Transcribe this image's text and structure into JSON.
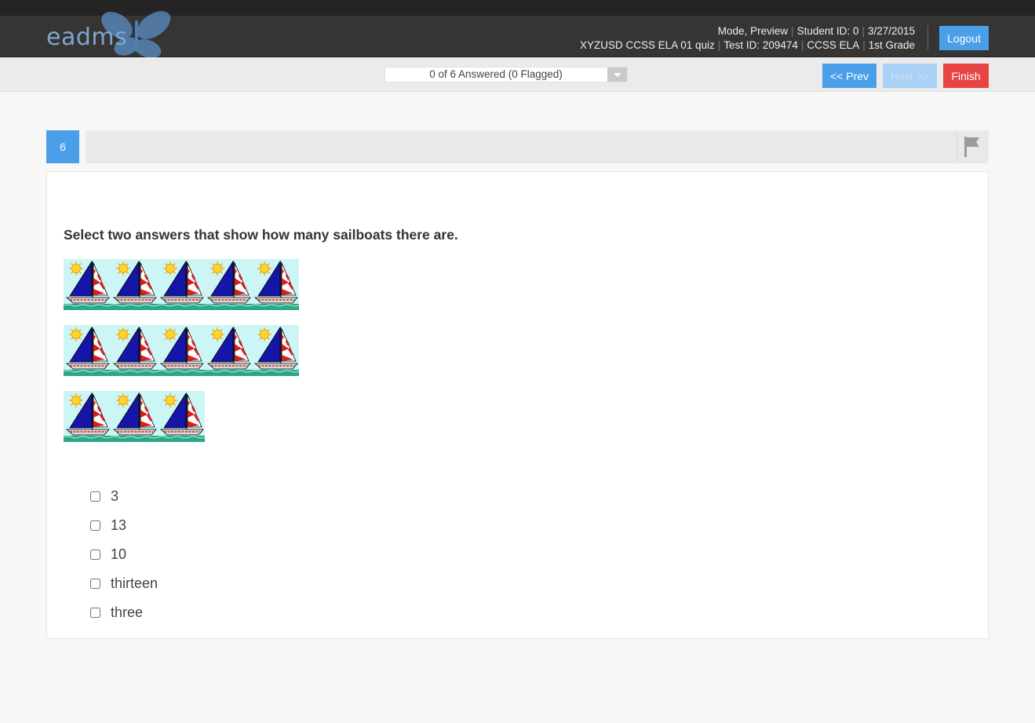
{
  "header": {
    "logo_text": "eadms",
    "mode": "Mode, Preview",
    "student_id": "Student ID: 0",
    "date": "3/27/2015",
    "quiz_name": "XYZUSD CCSS ELA 01 quiz",
    "test_id": "Test ID: 209474",
    "subject": "CCSS ELA",
    "grade": "1st Grade",
    "logout_label": "Logout"
  },
  "nav": {
    "progress_text": "0 of 6 Answered (0 Flagged)",
    "prev_label": "<< Prev",
    "next_label": "Next >>",
    "finish_label": "Finish"
  },
  "question": {
    "number": "6",
    "prompt": "Select two answers that show how many sailboats there are.",
    "boat_rows": [
      5,
      5,
      3
    ],
    "options": [
      "3",
      "13",
      "10",
      "thirteen",
      "three"
    ]
  },
  "colors": {
    "accent_blue": "#4a9fe8",
    "finish_red": "#e84444",
    "header_bg": "#363534"
  }
}
